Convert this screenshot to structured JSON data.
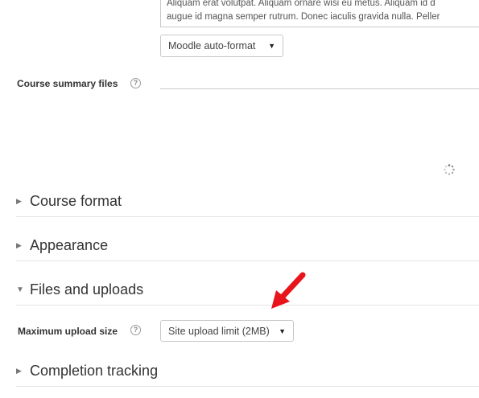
{
  "summary": {
    "line1": "Aliquam erat volutpat. Aliquam ornare wisi eu metus. Aliquam id d",
    "line2": "augue id magna semper rutrum. Donec iaculis gravida nulla. Peller"
  },
  "summary_format": {
    "selected": "Moodle auto-format"
  },
  "summary_files": {
    "label": "Course summary files",
    "help": "?"
  },
  "sections": {
    "course_format": "Course format",
    "appearance": "Appearance",
    "files_uploads": "Files and uploads",
    "completion": "Completion tracking"
  },
  "max_upload": {
    "label": "Maximum upload size",
    "help": "?",
    "selected": "Site upload limit (2MB)"
  },
  "annotation": {
    "color": "#e8141b"
  }
}
